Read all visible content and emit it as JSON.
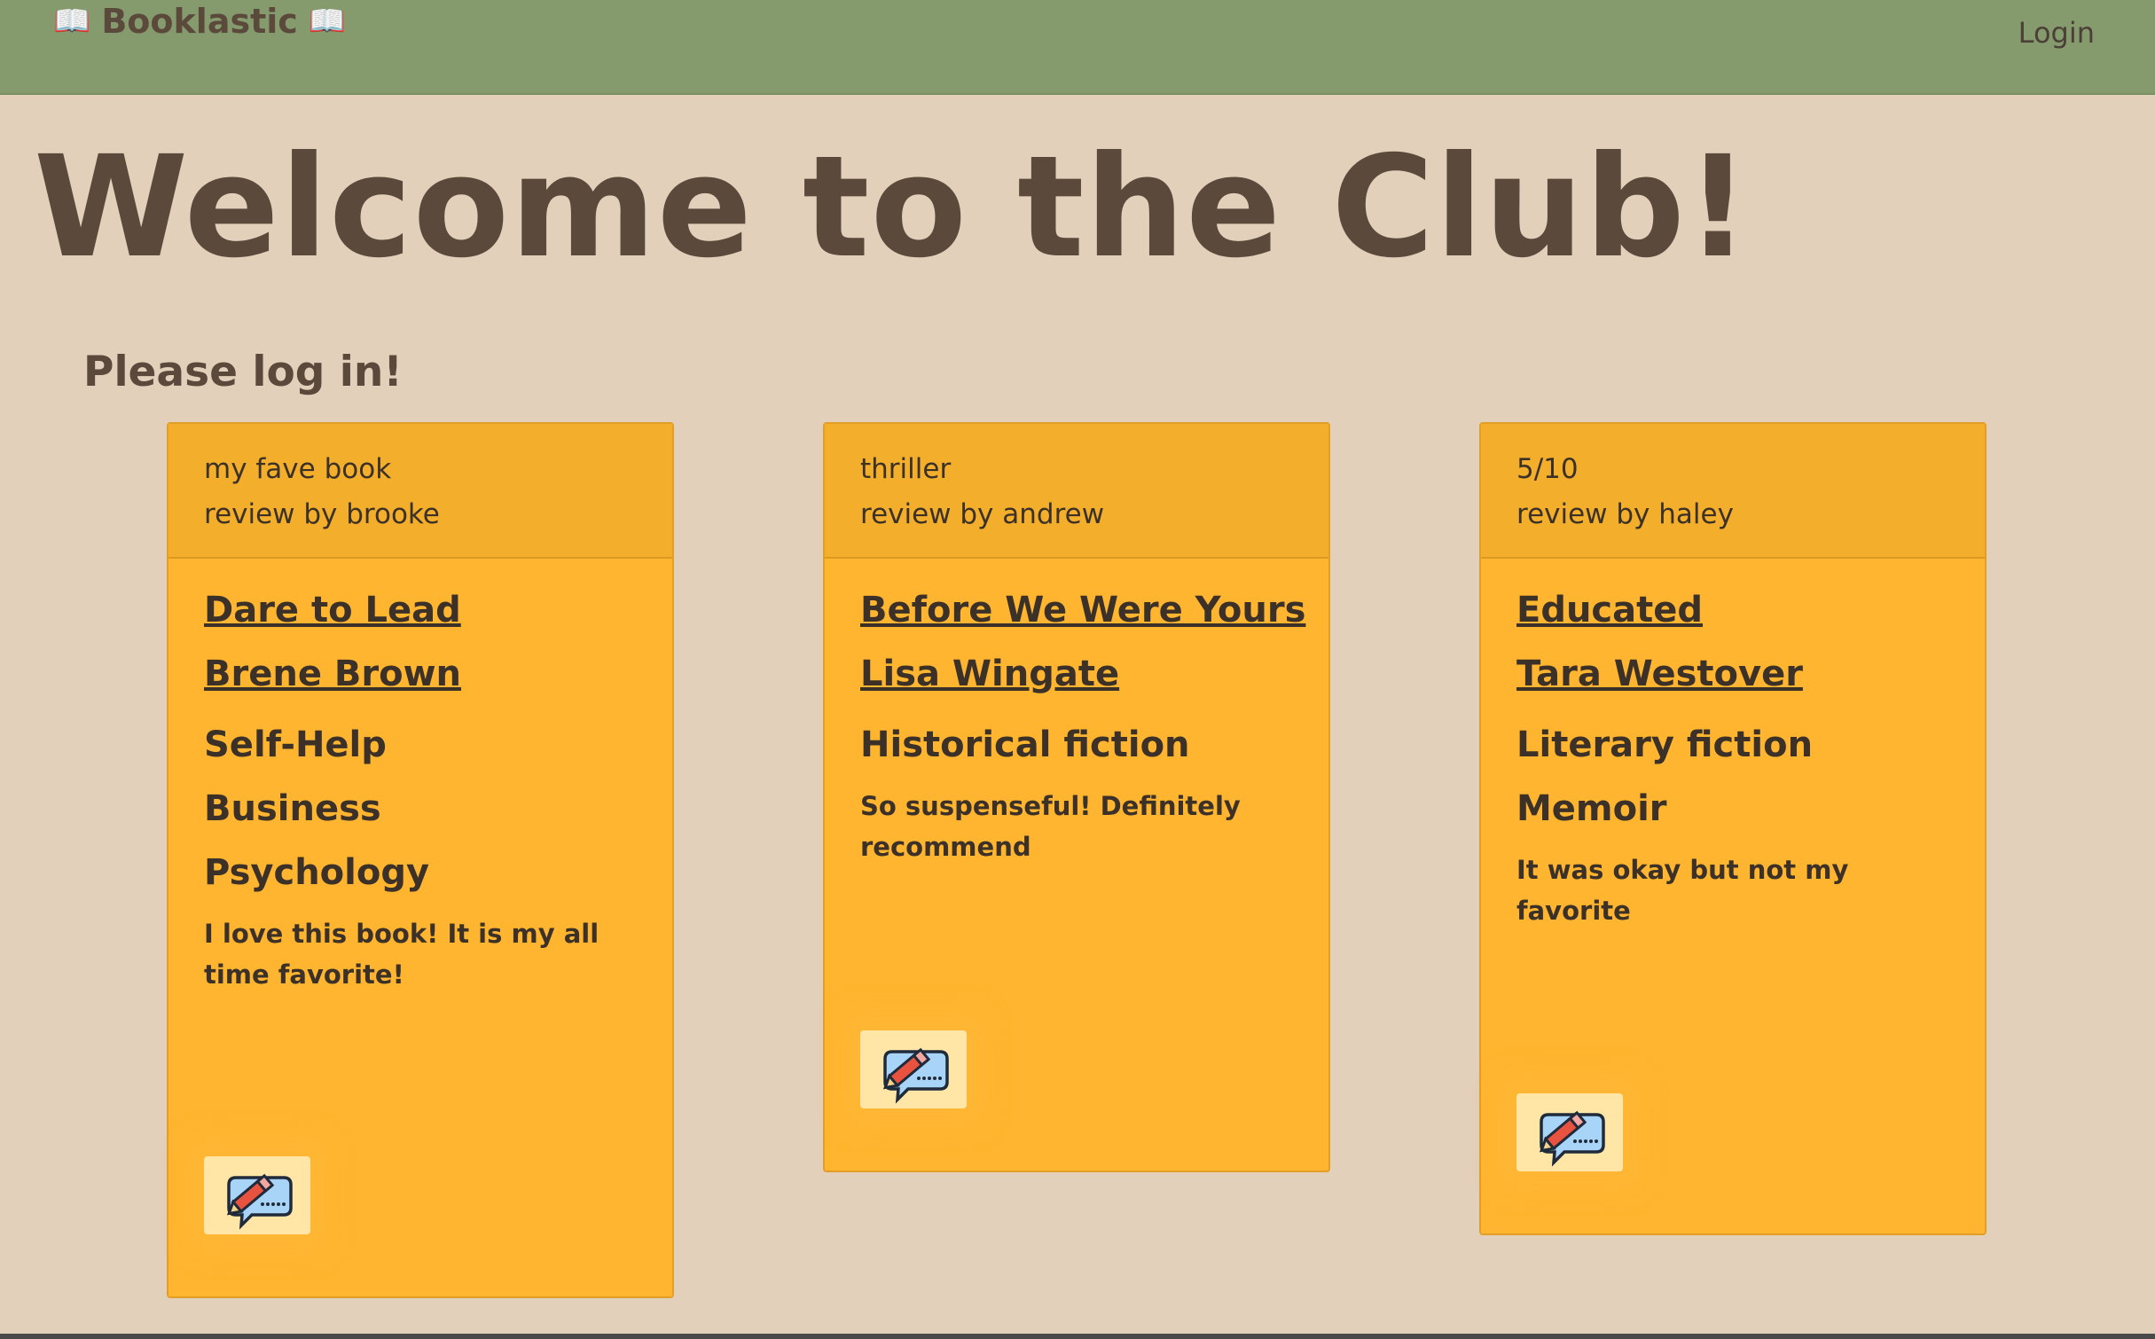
{
  "nav": {
    "brand": "Booklastic",
    "brand_icon": "📖",
    "login": "Login"
  },
  "main": {
    "title": "Welcome to the Club!",
    "subtitle": "Please log in!"
  },
  "cards": [
    {
      "header_title": "my fave book",
      "header_author": "review by brooke",
      "book_title": "Dare to Lead",
      "book_author": "Brene Brown",
      "genres": [
        "Self-Help",
        "Business",
        "Psychology"
      ],
      "review": "I love this book! It is my all time favorite!",
      "edit_icon": "edit-comment-icon"
    },
    {
      "header_title": "thriller",
      "header_author": "review by andrew",
      "book_title": "Before We Were Yours",
      "book_author": "Lisa Wingate",
      "genres": [
        "Historical fiction"
      ],
      "review": "So suspenseful! Definitely recommend",
      "edit_icon": "edit-comment-icon"
    },
    {
      "header_title": "5/10",
      "header_author": "review by haley",
      "book_title": "Educated",
      "book_author": "Tara Westover",
      "genres": [
        "Literary fiction",
        "Memoir"
      ],
      "review": "It was okay but not my favorite",
      "edit_icon": "edit-comment-icon"
    }
  ],
  "colors": {
    "navbar": "#859b6e",
    "background": "#e3d0bb",
    "card": "#ffb52f",
    "card_header": "#f3ae2c",
    "text": "#5b4a3c"
  }
}
